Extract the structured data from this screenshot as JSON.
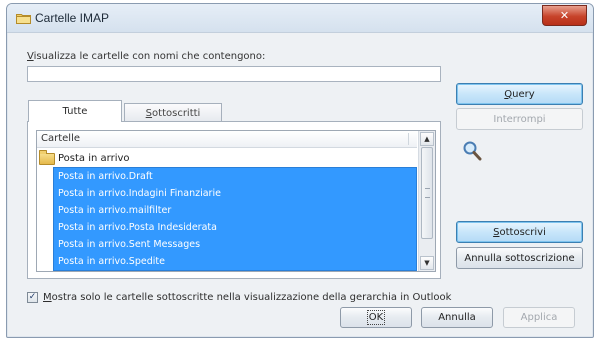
{
  "window": {
    "title": "Cartelle IMAP",
    "close_glyph": "✕",
    "icon": "folder-icon"
  },
  "filter": {
    "label_accel": "V",
    "label_rest": "isualizza le cartelle con nomi che contengono:",
    "value": "",
    "placeholder": ""
  },
  "tabs": [
    {
      "label": "Tutte",
      "accel": "",
      "selected": true
    },
    {
      "label": "ottoscritti",
      "accel": "S",
      "selected": false
    }
  ],
  "folder_list": {
    "header": "Cartelle",
    "root": "Posta in arrivo",
    "items": [
      "Posta in arrivo.Draft",
      "Posta in arrivo.Indagini Finanziarie",
      "Posta in arrivo.mailfilter",
      "Posta in arrivo.Posta Indesiderata",
      "Posta in arrivo.Sent Messages",
      "Posta in arrivo.Spedite"
    ],
    "selected_color": "#3399ff",
    "scroll_up_glyph": "▲",
    "scroll_down_glyph": "▼"
  },
  "side_buttons": {
    "query": {
      "accel": "Q",
      "rest": "uery",
      "enabled": true,
      "focused": true
    },
    "interrompi": {
      "label": "Interrompi",
      "enabled": false
    },
    "sottoscrivi": {
      "accel": "S",
      "rest": "ottoscrivi",
      "enabled": true,
      "focused": true
    },
    "annulla_sottoscrizione": {
      "label": "Annulla sottoscrizione",
      "enabled": true
    }
  },
  "checkbox": {
    "checked": true,
    "glyph": "✓",
    "label_accel": "M",
    "label_rest": "ostra solo le cartelle sottoscritte nella visualizzazione della gerarchia in Outlook"
  },
  "footer_buttons": {
    "ok": "OK",
    "annulla": "Annulla",
    "applica": "Applica"
  },
  "colors": {
    "accent": "#3399ff",
    "close": "#c7432a"
  }
}
